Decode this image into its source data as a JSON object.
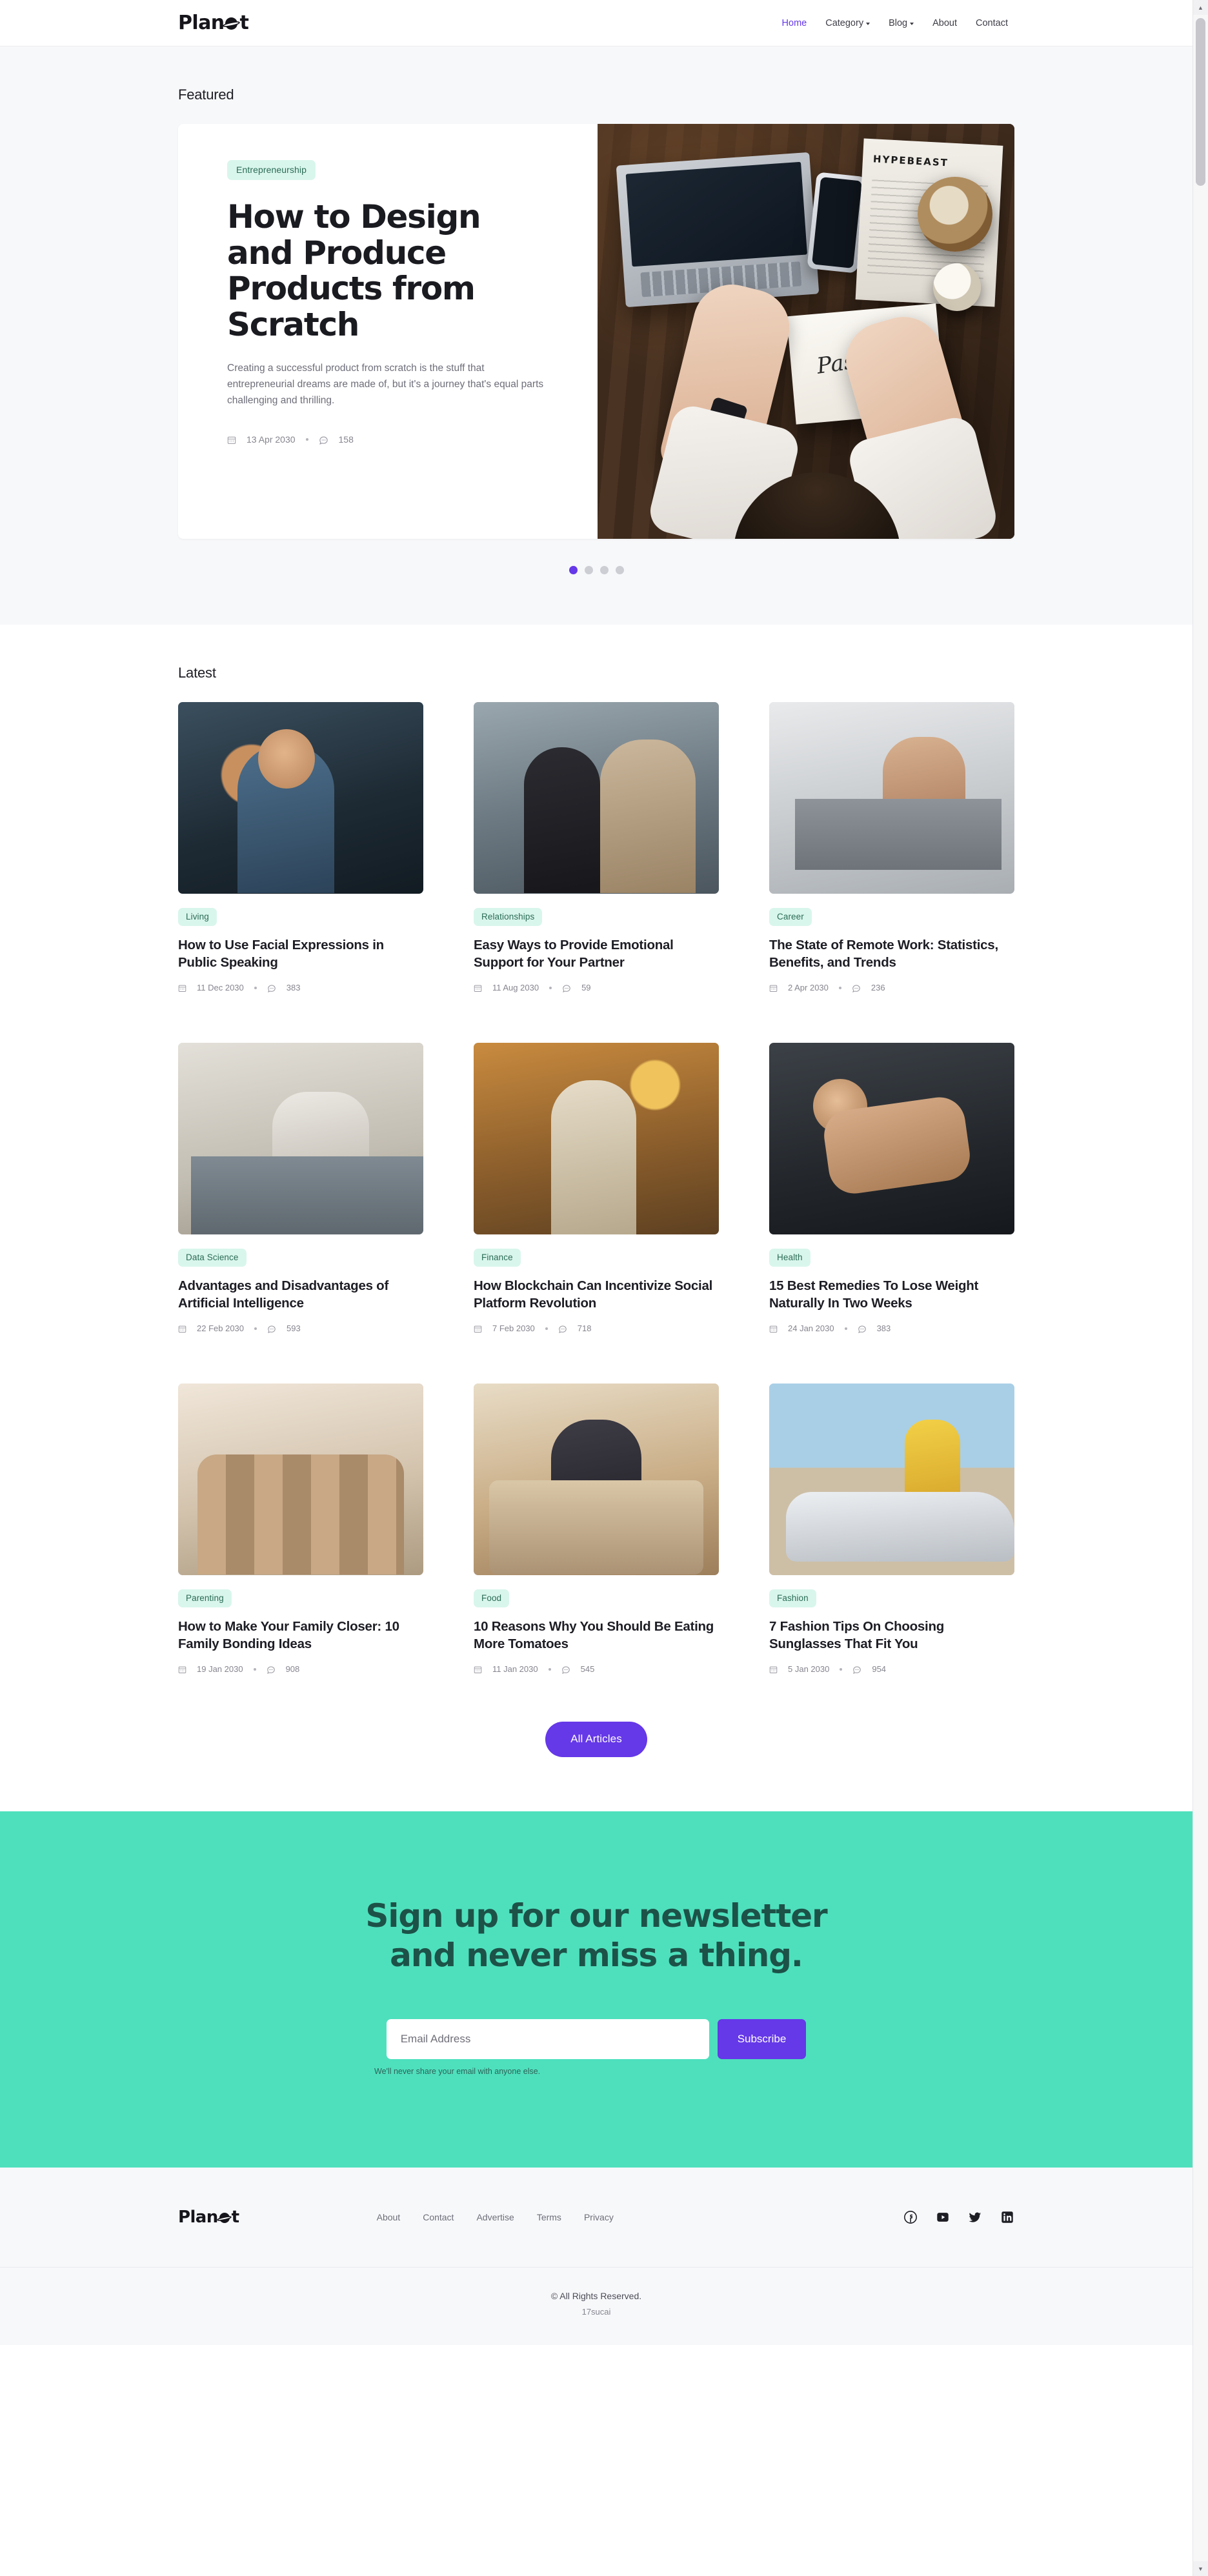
{
  "brand": {
    "name": "Planet",
    "prefix": "Plan",
    "suffix": "t"
  },
  "nav": {
    "items": [
      {
        "label": "Home",
        "active": true,
        "caret": false
      },
      {
        "label": "Category",
        "active": false,
        "caret": true
      },
      {
        "label": "Blog",
        "active": false,
        "caret": true
      },
      {
        "label": "About",
        "active": false,
        "caret": false
      },
      {
        "label": "Contact",
        "active": false,
        "caret": false
      }
    ]
  },
  "featured": {
    "section_label": "Featured",
    "category": "Entrepreneurship",
    "title": "How to Design and Produce Products from Scratch",
    "excerpt": "Creating a successful product from scratch is the stuff that entrepreneurial dreams are made of, but it's a journey that's equal parts challenging and thrilling.",
    "date": "13 Apr 2030",
    "comments": "158",
    "carousel": {
      "count": 4,
      "active_index": 0
    }
  },
  "latest": {
    "section_label": "Latest",
    "all_articles_label": "All Articles",
    "cards": [
      {
        "category": "Living",
        "title": "How to Use Facial Expressions in Public Speaking",
        "date": "11 Dec 2030",
        "comments": "383"
      },
      {
        "category": "Relationships",
        "title": "Easy Ways to Provide Emotional Support for Your Partner",
        "date": "11 Aug 2030",
        "comments": "59"
      },
      {
        "category": "Career",
        "title": "The State of Remote Work: Statistics, Benefits, and Trends",
        "date": "2 Apr 2030",
        "comments": "236"
      },
      {
        "category": "Data Science",
        "title": "Advantages and Disadvantages of Artificial Intelligence",
        "date": "22 Feb 2030",
        "comments": "593"
      },
      {
        "category": "Finance",
        "title": "How Blockchain Can Incentivize Social Platform Revolution",
        "date": "7 Feb 2030",
        "comments": "718"
      },
      {
        "category": "Health",
        "title": "15 Best Remedies To Lose Weight Naturally In Two Weeks",
        "date": "24 Jan 2030",
        "comments": "383"
      },
      {
        "category": "Parenting",
        "title": "How to Make Your Family Closer: 10 Family Bonding Ideas",
        "date": "19 Jan 2030",
        "comments": "908"
      },
      {
        "category": "Food",
        "title": "10 Reasons Why You Should Be Eating More Tomatoes",
        "date": "11 Jan 2030",
        "comments": "545"
      },
      {
        "category": "Fashion",
        "title": "7 Fashion Tips On Choosing Sunglasses That Fit You",
        "date": "5 Jan 2030",
        "comments": "954"
      }
    ]
  },
  "newsletter": {
    "title_line1": "Sign up for our newsletter",
    "title_line2": "and never miss a thing.",
    "email_placeholder": "Email Address",
    "email_value": "",
    "subscribe_label": "Subscribe",
    "note": "We'll never share your email with anyone else."
  },
  "footer": {
    "links": [
      {
        "label": "About"
      },
      {
        "label": "Contact"
      },
      {
        "label": "Advertise"
      },
      {
        "label": "Terms"
      },
      {
        "label": "Privacy"
      }
    ],
    "socials": [
      {
        "name": "facebook-icon"
      },
      {
        "name": "youtube-icon"
      },
      {
        "name": "twitter-icon"
      },
      {
        "name": "linkedin-icon"
      }
    ],
    "copyright": "© All Rights Reserved.",
    "credit": "17sucai"
  },
  "colors": {
    "accent_purple": "#6538e8",
    "newsletter_teal": "#4ee0bd",
    "chip_bg": "#d9f6ec",
    "chip_text": "#2b6b56",
    "text_dark": "#1d1d24",
    "text_muted": "#6e6e7a"
  }
}
